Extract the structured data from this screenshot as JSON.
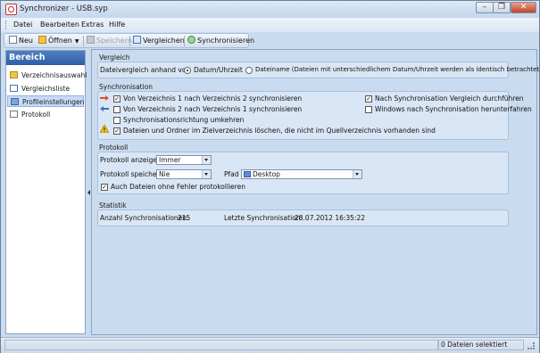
{
  "window": {
    "title": "Synchronizer - USB.syp",
    "min": "–",
    "restore": "❐",
    "close": "✕"
  },
  "menu": {
    "items": [
      "Datei",
      "Bearbeiten",
      "Extras",
      "Hilfe"
    ]
  },
  "toolbar": {
    "new": "Neu",
    "open": "Öffnen",
    "save": "Speichern",
    "compare": "Vergleichen",
    "sync": "Synchronisieren"
  },
  "sidebar": {
    "header": "Bereich",
    "items": [
      {
        "label": "Verzeichnisauswahl",
        "icon": "folders-icon",
        "active": false
      },
      {
        "label": "Vergleichsliste",
        "icon": "list-icon",
        "active": false
      },
      {
        "label": "Profileinstellungen",
        "icon": "profile-icon",
        "active": true
      },
      {
        "label": "Protokoll",
        "icon": "document-icon",
        "active": false
      }
    ]
  },
  "vergleich": {
    "title": "Vergleich",
    "label": "Dateivergleich anhand von",
    "option1": "Datum/Uhrzeit",
    "option2": "Dateiname (Dateien mit unterschiedlichem Datum/Uhrzeit werden als identisch betrachtet)",
    "selected": "option1"
  },
  "sync": {
    "title": "Synchronisation",
    "dir1to2": "Von Verzeichnis 1 nach Verzeichnis 2 synchronisieren",
    "dir2to1": "Von Verzeichnis 2 nach Verzeichnis 1 synchronisieren",
    "reverse": "Synchronisationsrichtung umkehren",
    "delete": "Dateien und Ordner im Zielverzeichnis löschen, die nicht im Quellverzeichnis vorhanden sind",
    "after_compare": "Nach Synchronisation Vergleich durchführen",
    "shutdown": "Windows nach Synchronisation herunterfahren",
    "checked": {
      "dir1to2": true,
      "dir2to1": false,
      "reverse": false,
      "delete": true,
      "after_compare": true,
      "shutdown": false
    }
  },
  "protokoll": {
    "title": "Protokoll",
    "show_label": "Protokoll anzeigen",
    "show_value": "Immer",
    "save_label": "Protokoll speichern",
    "save_value": "Nie",
    "path_label": "Pfad",
    "path_value": "Desktop",
    "no_error": "Auch Dateien ohne Fehler protokollieren",
    "no_error_checked": true
  },
  "statistik": {
    "title": "Statistik",
    "count_label": "Anzahl Synchronisationen:",
    "count_value": "215",
    "last_label": "Letzte Synchronisation:",
    "last_value": "28.07.2012 16:35:22"
  },
  "status": {
    "text": "0 Dateien selektiert"
  },
  "colors": {
    "accent": "#2d5da6",
    "arrow_right": "#d9532b",
    "arrow_left": "#3b72c4",
    "warning": "#f2c200"
  }
}
